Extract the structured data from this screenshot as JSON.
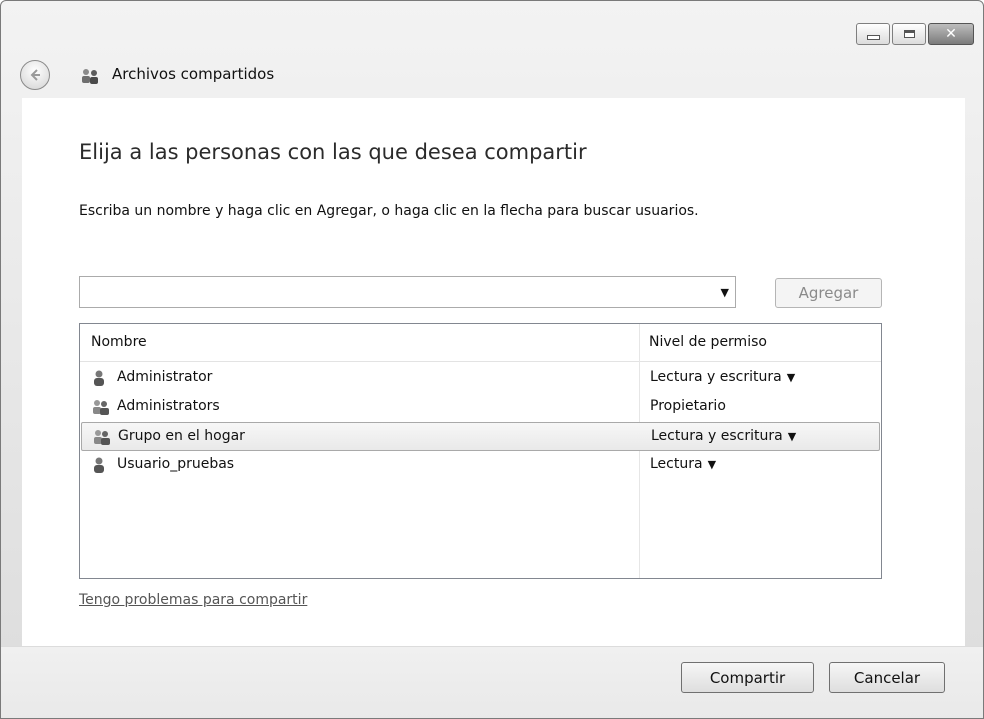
{
  "window": {
    "title": "Archivos compartidos",
    "caption_buttons": {
      "close_glyph": "✕"
    }
  },
  "content": {
    "heading": "Elija a las personas con las que desea compartir",
    "instructions": "Escriba un nombre y haga clic en Agregar, o haga clic en la flecha para buscar usuarios.",
    "combo": {
      "value": "",
      "arrow": "▼"
    },
    "add_button": "Agregar",
    "list": {
      "columns": [
        "Nombre",
        "Nivel de permiso"
      ],
      "rows": [
        {
          "name": "Administrator",
          "icon": "user-icon",
          "permission": "Lectura y escritura",
          "dropdown": "▼",
          "selected": false
        },
        {
          "name": "Administrators",
          "icon": "group-icon",
          "permission": "Propietario",
          "dropdown": "",
          "selected": false
        },
        {
          "name": "Grupo en el hogar",
          "icon": "group-icon",
          "permission": "Lectura y escritura",
          "dropdown": "▼",
          "selected": true
        },
        {
          "name": "Usuario_pruebas",
          "icon": "user-icon",
          "permission": "Lectura",
          "dropdown": "▼",
          "selected": false
        }
      ]
    },
    "help_link": "Tengo problemas para compartir"
  },
  "footer": {
    "share_button": "Compartir",
    "cancel_button": "Cancelar"
  },
  "colors": {
    "accent": "#2b2b2b",
    "link": "#555555"
  }
}
